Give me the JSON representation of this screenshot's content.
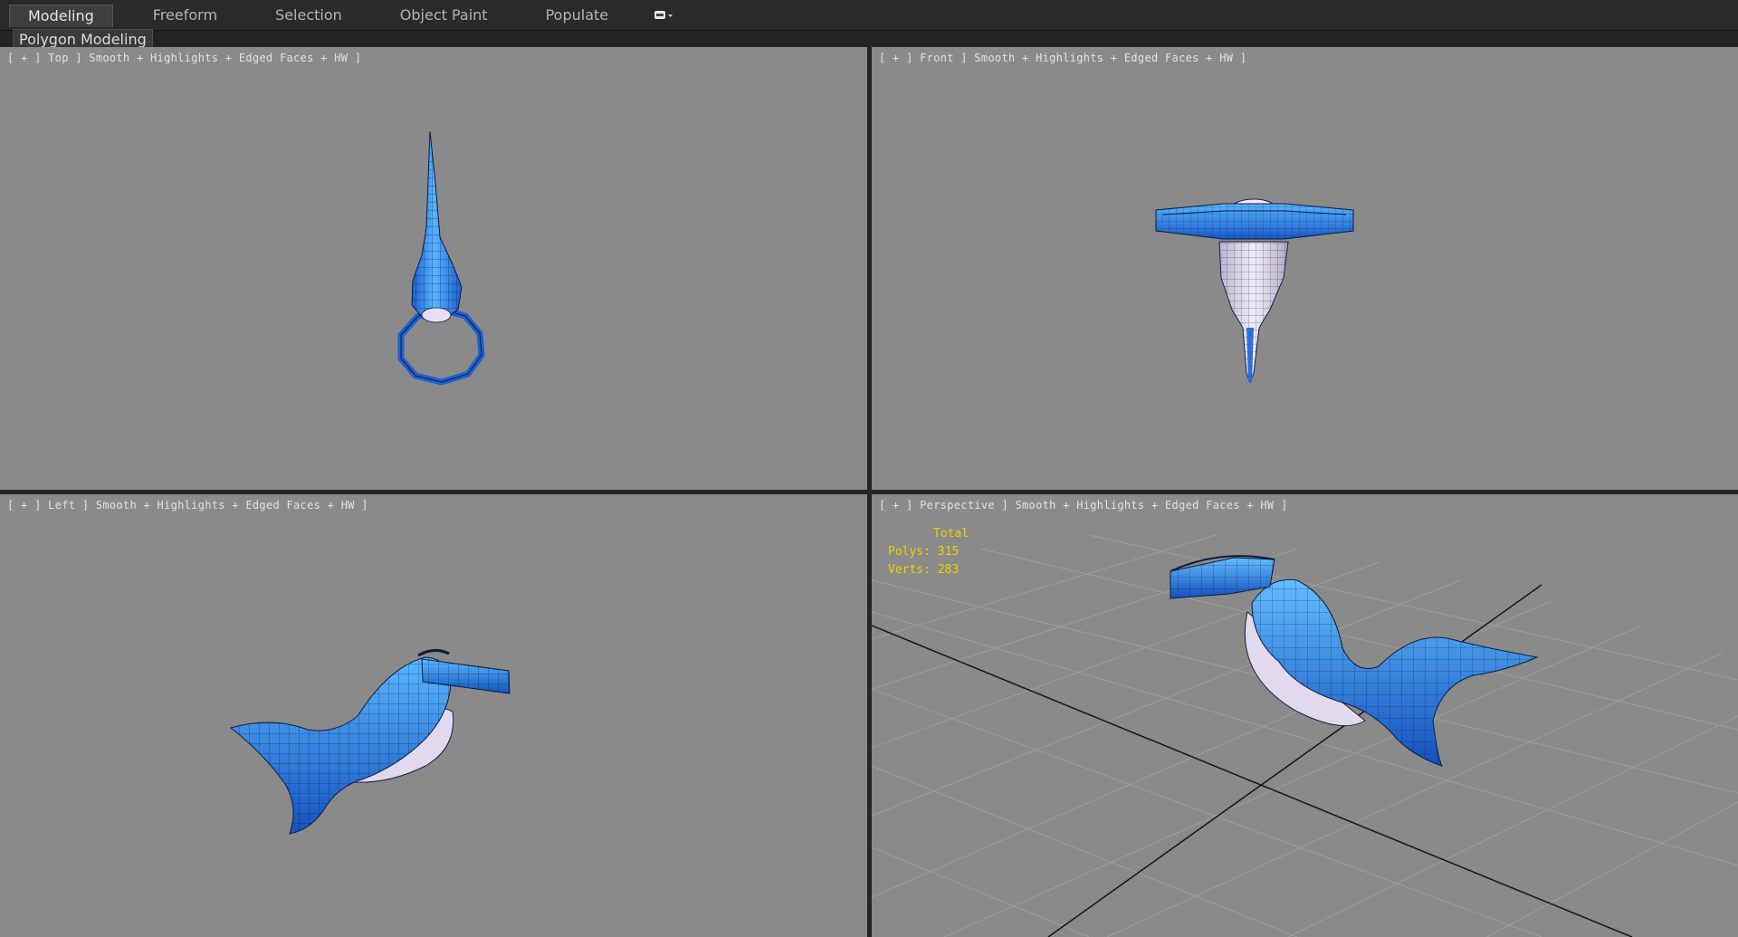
{
  "ribbon": {
    "tabs": [
      {
        "label": "Modeling",
        "active": true
      },
      {
        "label": "Freeform",
        "active": false
      },
      {
        "label": "Selection",
        "active": false
      },
      {
        "label": "Object Paint",
        "active": false
      },
      {
        "label": "Populate",
        "active": false
      }
    ],
    "options_icon": "ribbon-menu-icon"
  },
  "subbar": {
    "panel_label": "Polygon Modeling"
  },
  "viewports": {
    "top": {
      "label": "[ + ] Top ] Smooth + Highlights + Edged Faces + HW ]"
    },
    "front": {
      "label": "[ + ] Front ] Smooth + Highlights + Edged Faces + HW ]"
    },
    "left": {
      "label": "[ + ] Left ] Smooth + Highlights + Edged Faces + HW ]"
    },
    "perspective": {
      "label": "[ + ] Perspective ] Smooth + Highlights + Edged Faces + HW ]",
      "stats": {
        "title": "Total",
        "polys": "Polys: 315",
        "verts": "Verts: 283"
      }
    }
  },
  "colors": {
    "viewport_bg": "#8a8a8a",
    "model_blue": "#2f86ee",
    "model_light": "#e6dff0",
    "stats_text": "#f0d000",
    "grid_line": "#9d9d9d"
  }
}
